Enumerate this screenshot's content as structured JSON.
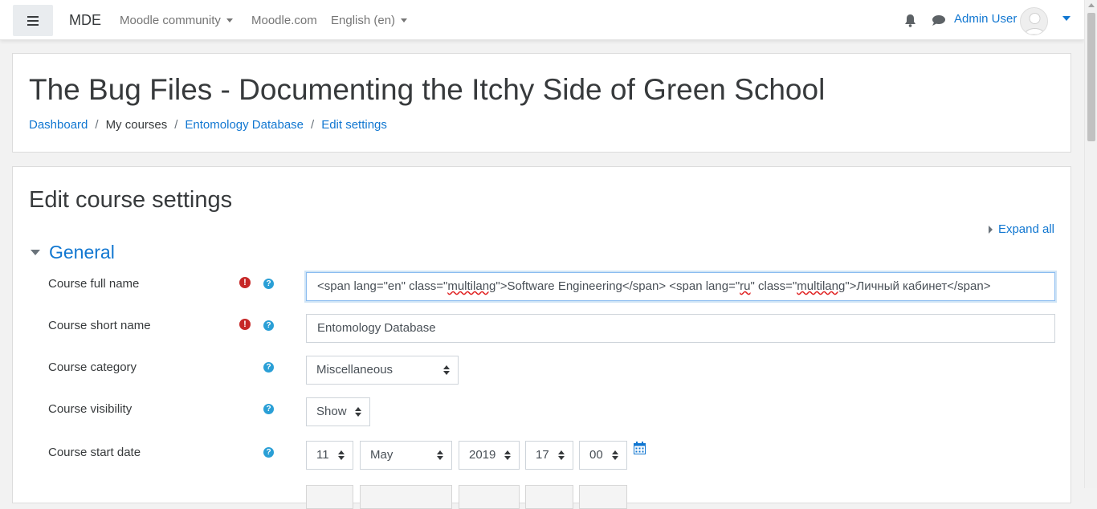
{
  "navbar": {
    "brand": "MDE",
    "links": [
      "Moodle community",
      "Moodle.com",
      "English ‎(en)‎"
    ],
    "user_name": "Admin User",
    "icons": [
      "menu-icon",
      "bell-icon",
      "chat-icon",
      "avatar",
      "chevron-down-icon"
    ]
  },
  "header": {
    "course_title": "The Bug Files - Documenting the Itchy Side of Green School",
    "breadcrumb": [
      "Dashboard",
      "My courses",
      "Entomology Database",
      "Edit settings"
    ],
    "separator": "/"
  },
  "page": {
    "heading": "Edit course settings",
    "expand_all": "Expand all",
    "section": "General"
  },
  "form": {
    "full_name": {
      "label": "Course full name",
      "value_parts": [
        "<span lang=\"en\" class=\"",
        "multilang",
        "\">Software Engineering</span>  <span lang=\"",
        "ru",
        "\" class=\"",
        "multilang",
        "\">Личный кабинет</span>"
      ]
    },
    "short_name": {
      "label": "Course short name",
      "value": "Entomology Database"
    },
    "category": {
      "label": "Course category",
      "value": "Miscellaneous"
    },
    "visibility": {
      "label": "Course visibility",
      "value": "Show"
    },
    "start_date": {
      "label": "Course start date",
      "day": "11",
      "month": "May",
      "year": "2019",
      "hour": "17",
      "minute": "00"
    }
  },
  "colors": {
    "link": "#1177d1",
    "required": "#c62828",
    "help": "#2a9fd6"
  }
}
